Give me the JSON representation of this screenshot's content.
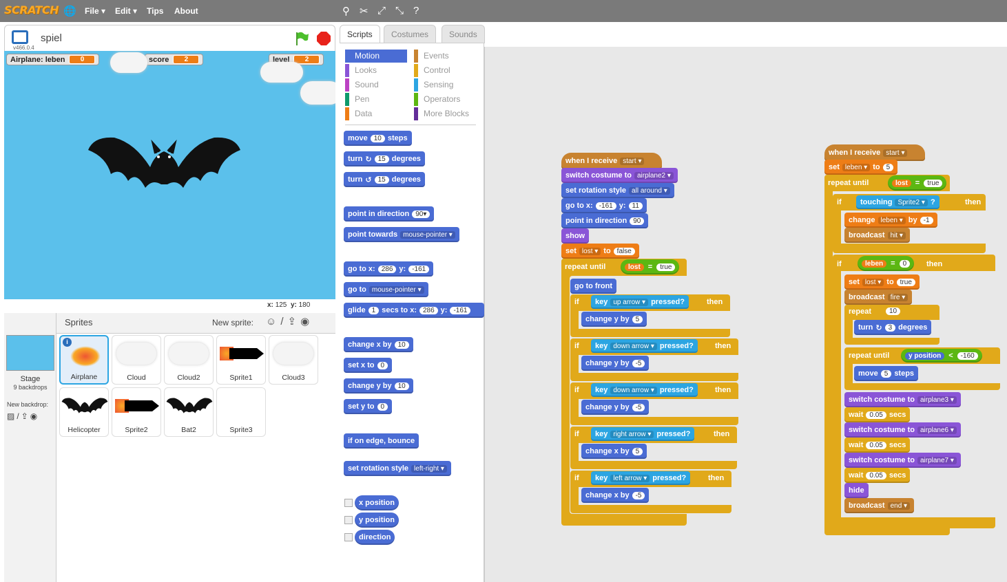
{
  "menu": {
    "logo": "SCRATCH",
    "file": "File ▾",
    "edit": "Edit ▾",
    "tips": "Tips",
    "about": "About"
  },
  "stage": {
    "title": "spiel",
    "version": "v466.0.4",
    "coord_x_label": "x:",
    "coord_x": "125",
    "coord_y_label": "y:",
    "coord_y": "180",
    "monitors": [
      {
        "label": "Airplane: leben",
        "value": "0"
      },
      {
        "label": "score",
        "value": "2"
      },
      {
        "label": "level",
        "value": "2"
      }
    ]
  },
  "sprites": {
    "header": "Sprites",
    "new_sprite": "New sprite:",
    "stage_label": "Stage",
    "backdrops": "9 backdrops",
    "new_backdrop": "New backdrop:",
    "items": [
      "Airplane",
      "Cloud",
      "Cloud2",
      "Sprite1",
      "Cloud3",
      "Helicopter",
      "Sprite2",
      "Bat2",
      "Sprite3"
    ]
  },
  "tabs": [
    "Scripts",
    "Costumes",
    "Sounds"
  ],
  "categories": [
    "Motion",
    "Looks",
    "Sound",
    "Pen",
    "Data",
    "Events",
    "Control",
    "Sensing",
    "Operators",
    "More Blocks"
  ],
  "palette": {
    "move": "move",
    "move_n": "10",
    "steps": "steps",
    "turn": "turn",
    "turn_r": "15",
    "degrees": "degrees",
    "turn_l": "15",
    "point_dir": "point in direction",
    "point_dir_n": "90▾",
    "point_towards": "point towards",
    "mouse_pointer": "mouse-pointer",
    "goto_xy": "go to x:",
    "goto_x": "286",
    "y_lbl": "y:",
    "goto_y": "-161",
    "goto": "go to",
    "glide": "glide",
    "glide_n": "1",
    "secs_to_x": "secs to x:",
    "glide_x": "286",
    "glide_y": "-161",
    "change_x": "change x by",
    "change_x_n": "10",
    "set_x": "set x to",
    "set_x_n": "0",
    "change_y": "change y by",
    "change_y_n": "10",
    "set_y": "set y to",
    "set_y_n": "0",
    "edge": "if on edge, bounce",
    "rot_style": "set rotation style",
    "left_right": "left-right",
    "xpos": "x position",
    "ypos": "y position",
    "direction": "direction"
  },
  "script1": {
    "when_receive": "when I receive",
    "msg_start": "start",
    "switch_costume": "switch costume to",
    "costume_airplane2": "airplane2",
    "set_rot": "set rotation style",
    "all_around": "all around",
    "goto_xy": "go to x:",
    "x": "-161",
    "y_lbl": "y:",
    "y": "11",
    "point_dir": "point in direction",
    "dir": "90",
    "show": "show",
    "set": "set",
    "var_lost": "lost",
    "to": "to",
    "false": "false",
    "repeat_until": "repeat until",
    "true": "true",
    "eq": "=",
    "go_front": "go to front",
    "if": "if",
    "key": "key",
    "pressed": "pressed?",
    "then": "then",
    "up_arrow": "up arrow",
    "down_arrow": "down arrow",
    "right_arrow": "right arrow",
    "left_arrow": "left arrow",
    "change_y": "change y by",
    "change_x": "change x by",
    "p5": "5",
    "m5": "-5"
  },
  "script2": {
    "when_receive": "when I receive",
    "msg_start": "start",
    "set": "set",
    "var_leben": "leben",
    "to": "to",
    "leben_val": "5",
    "repeat_until": "repeat until",
    "var_lost": "lost",
    "eq": "=",
    "true": "true",
    "if": "if",
    "touching": "touching",
    "sprite2": "Sprite2",
    "q": "?",
    "then": "then",
    "change": "change",
    "by": "by",
    "m1": "-1",
    "broadcast": "broadcast",
    "hit": "hit",
    "leben_r": "leben",
    "zero": "0",
    "fire": "fire",
    "repeat": "repeat",
    "ten": "10",
    "turn": "turn",
    "three": "3",
    "degrees": "degrees",
    "ypos": "y position",
    "lt": "<",
    "m160": "-160",
    "move": "move",
    "five": "5",
    "steps": "steps",
    "switch_costume": "switch costume to",
    "airplane3": "airplane3",
    "airplane6": "airplane6",
    "airplane7": "airplane7",
    "wait": "wait",
    "w005": "0.05",
    "secs": "secs",
    "hide": "hide",
    "end": "end"
  }
}
